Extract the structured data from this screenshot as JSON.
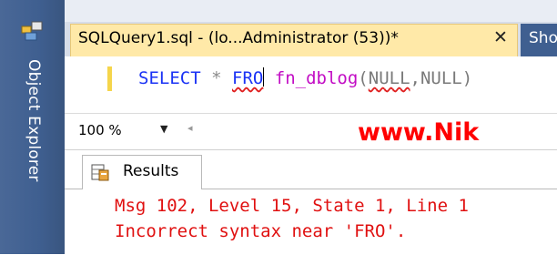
{
  "side_panel": {
    "label": "Object Explorer",
    "icon": "object-explorer-icon"
  },
  "tabs": {
    "active_title": "SQLQuery1.sql - (lo...Administrator (53))*",
    "close_glyph": "✕",
    "next_title": "Sho"
  },
  "editor": {
    "tokens": {
      "select": "SELECT",
      "star": "*",
      "fro": "FRO",
      "fn": "fn_dblog",
      "open_paren": "(",
      "null1": "NULL",
      "comma": ",",
      "null2": "NULL",
      "close_paren": ")"
    }
  },
  "zoom": {
    "value": "100 %"
  },
  "watermark": "www.Nik",
  "results": {
    "tab_label": "Results",
    "messages": [
      "Msg 102, Level 15, State 1, Line 1",
      "Incorrect syntax near 'FRO'."
    ]
  },
  "colors": {
    "error_text": "#e01010",
    "keyword": "#1b33f5",
    "function": "#c20dc4",
    "active_tab": "#ffe9a8",
    "side_panel": "#3f5f90"
  }
}
